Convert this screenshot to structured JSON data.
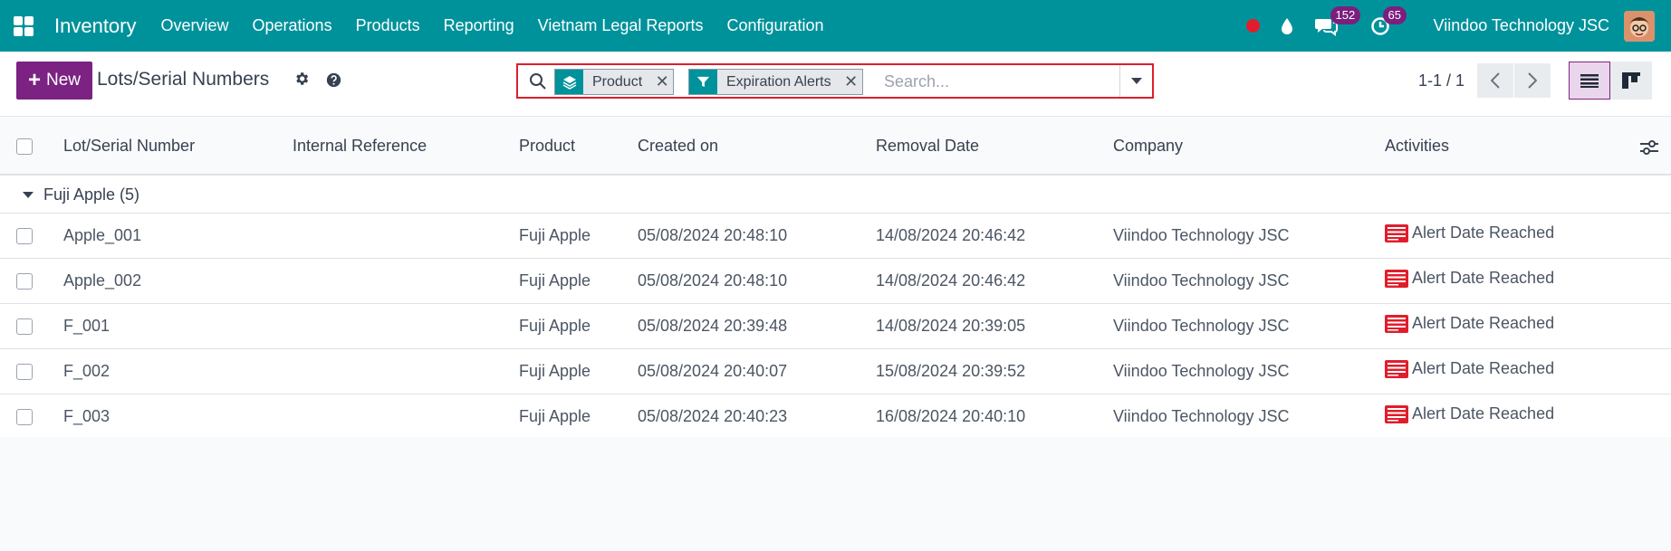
{
  "navbar": {
    "app_title": "Inventory",
    "menu": [
      "Overview",
      "Operations",
      "Products",
      "Reporting",
      "Vietnam Legal Reports",
      "Configuration"
    ],
    "messages_count": "152",
    "activities_count": "65",
    "company": "Viindoo Technology JSC"
  },
  "control": {
    "new_label": "New",
    "title": "Lots/Serial Numbers",
    "facets": [
      {
        "icon": "layers-icon",
        "label": "Product"
      },
      {
        "icon": "filter-icon",
        "label": "Expiration Alerts"
      }
    ],
    "search_placeholder": "Search...",
    "pager": "1-1 / 1"
  },
  "table": {
    "columns": [
      "Lot/Serial Number",
      "Internal Reference",
      "Product",
      "Created on",
      "Removal Date",
      "Company",
      "Activities"
    ],
    "group": {
      "label": "Fuji Apple (5)"
    },
    "rows": [
      {
        "lot": "Apple_001",
        "ref": "",
        "product": "Fuji Apple",
        "created": "05/08/2024 20:48:10",
        "removal": "14/08/2024 20:46:42",
        "company": "Viindoo Technology JSC",
        "activity": "Alert Date Reached"
      },
      {
        "lot": "Apple_002",
        "ref": "",
        "product": "Fuji Apple",
        "created": "05/08/2024 20:48:10",
        "removal": "14/08/2024 20:46:42",
        "company": "Viindoo Technology JSC",
        "activity": "Alert Date Reached"
      },
      {
        "lot": "F_001",
        "ref": "",
        "product": "Fuji Apple",
        "created": "05/08/2024 20:39:48",
        "removal": "14/08/2024 20:39:05",
        "company": "Viindoo Technology JSC",
        "activity": "Alert Date Reached"
      },
      {
        "lot": "F_002",
        "ref": "",
        "product": "Fuji Apple",
        "created": "05/08/2024 20:40:07",
        "removal": "15/08/2024 20:39:52",
        "company": "Viindoo Technology JSC",
        "activity": "Alert Date Reached"
      },
      {
        "lot": "F_003",
        "ref": "",
        "product": "Fuji Apple",
        "created": "05/08/2024 20:40:23",
        "removal": "16/08/2024 20:40:10",
        "company": "Viindoo Technology JSC",
        "activity": "Alert Date Reached"
      }
    ]
  },
  "colors": {
    "navbar": "#00929b",
    "primary": "#7b2283",
    "highlight": "#dc1f2c",
    "alert": "#e11d2b"
  }
}
